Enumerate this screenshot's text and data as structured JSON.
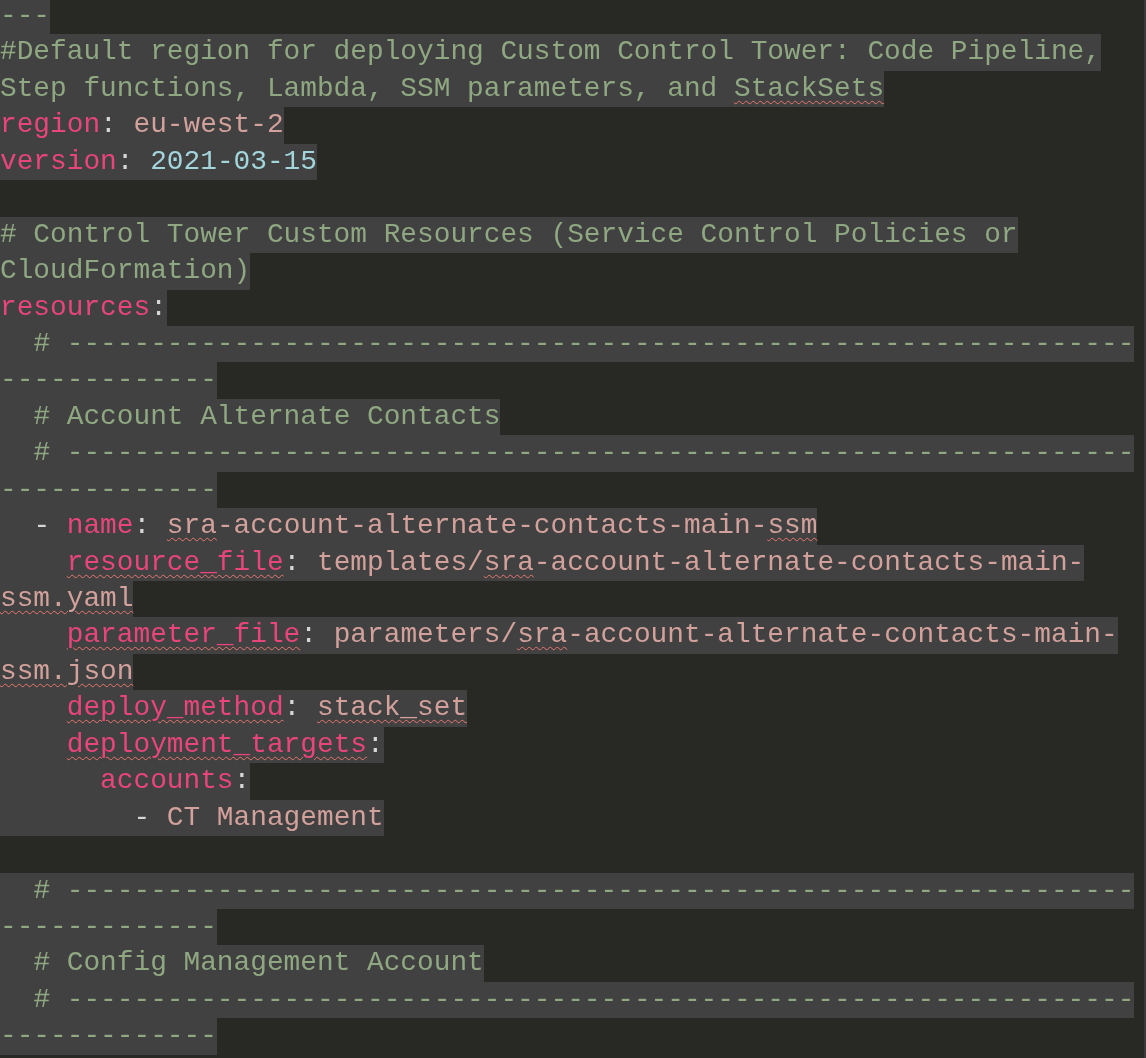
{
  "editor": {
    "lines": [
      {
        "selected": true,
        "tokens": [
          {
            "kind": "comment",
            "text": "---"
          }
        ]
      },
      {
        "selected": true,
        "tokens": [
          {
            "kind": "comment",
            "text": "#Default region for deploying Custom Control Tower: Code Pipeline,"
          }
        ]
      },
      {
        "selected": true,
        "tokens": [
          {
            "kind": "comment",
            "text": "Step functions, Lambda, SSM parameters, and "
          },
          {
            "kind": "comment",
            "text": "StackSets",
            "squiggle": true
          }
        ]
      },
      {
        "selected": true,
        "tokens": [
          {
            "kind": "key",
            "text": "region"
          },
          {
            "kind": "punct",
            "text": ": "
          },
          {
            "kind": "string",
            "text": "eu-west-2"
          }
        ]
      },
      {
        "selected": true,
        "tokens": [
          {
            "kind": "key",
            "text": "version"
          },
          {
            "kind": "punct",
            "text": ": "
          },
          {
            "kind": "number",
            "text": "2021-03-15"
          }
        ]
      },
      {
        "selected": false
      },
      {
        "selected": true,
        "tokens": [
          {
            "kind": "comment",
            "text": "# Control Tower Custom Resources (Service Control Policies or"
          }
        ]
      },
      {
        "selected": true,
        "tokens": [
          {
            "kind": "comment",
            "text": "CloudFormation)"
          }
        ]
      },
      {
        "selected": true,
        "tokens": [
          {
            "kind": "key",
            "text": "resources"
          },
          {
            "kind": "punct",
            "text": ":"
          }
        ]
      },
      {
        "selected": true,
        "tokens": [
          {
            "kind": "comment",
            "text": "  # ----------------------------------------------------------------"
          }
        ]
      },
      {
        "selected": true,
        "tokens": [
          {
            "kind": "comment",
            "text": "-------------"
          }
        ]
      },
      {
        "selected": true,
        "tokens": [
          {
            "kind": "comment",
            "text": "  # Account Alternate Contacts"
          }
        ]
      },
      {
        "selected": true,
        "tokens": [
          {
            "kind": "comment",
            "text": "  # ----------------------------------------------------------------"
          }
        ]
      },
      {
        "selected": true,
        "tokens": [
          {
            "kind": "comment",
            "text": "-------------"
          }
        ]
      },
      {
        "selected": true,
        "tokens": [
          {
            "kind": "punct",
            "text": "  - "
          },
          {
            "kind": "key",
            "text": "name"
          },
          {
            "kind": "punct",
            "text": ": "
          },
          {
            "kind": "string",
            "text": "sra",
            "squiggle": true
          },
          {
            "kind": "string",
            "text": "-account-alternate-contacts-main-"
          },
          {
            "kind": "string",
            "text": "ssm",
            "squiggle": true
          }
        ]
      },
      {
        "selected": true,
        "tokens": [
          {
            "kind": "key",
            "text": "    resource_file",
            "squiggle": true
          },
          {
            "kind": "punct",
            "text": ": "
          },
          {
            "kind": "string",
            "text": "templates/"
          },
          {
            "kind": "string",
            "text": "sra",
            "squiggle": true
          },
          {
            "kind": "string",
            "text": "-account-alternate-contacts-main-"
          }
        ]
      },
      {
        "selected": true,
        "tokens": [
          {
            "kind": "string",
            "text": "ssm.yaml",
            "squiggle": true
          }
        ]
      },
      {
        "selected": true,
        "tokens": [
          {
            "kind": "key",
            "text": "    parameter_file",
            "squiggle": true
          },
          {
            "kind": "punct",
            "text": ": "
          },
          {
            "kind": "string",
            "text": "parameters/"
          },
          {
            "kind": "string",
            "text": "sra",
            "squiggle": true
          },
          {
            "kind": "string",
            "text": "-account-alternate-contacts-main-"
          }
        ]
      },
      {
        "selected": true,
        "tokens": [
          {
            "kind": "string",
            "text": "ssm.json",
            "squiggle": true
          }
        ]
      },
      {
        "selected": true,
        "tokens": [
          {
            "kind": "key",
            "text": "    deploy_method",
            "squiggle": true
          },
          {
            "kind": "punct",
            "text": ": "
          },
          {
            "kind": "string",
            "text": "stack_set",
            "squiggle": true
          }
        ]
      },
      {
        "selected": true,
        "tokens": [
          {
            "kind": "key",
            "text": "    deployment_targets",
            "squiggle": true
          },
          {
            "kind": "punct",
            "text": ":"
          }
        ]
      },
      {
        "selected": true,
        "tokens": [
          {
            "kind": "key",
            "text": "      accounts"
          },
          {
            "kind": "punct",
            "text": ":"
          }
        ]
      },
      {
        "selected": true,
        "tokens": [
          {
            "kind": "punct",
            "text": "        - "
          },
          {
            "kind": "string",
            "text": "CT Management"
          }
        ]
      },
      {
        "selected": false
      },
      {
        "selected": true,
        "tokens": [
          {
            "kind": "comment",
            "text": "  # ----------------------------------------------------------------"
          }
        ]
      },
      {
        "selected": true,
        "tokens": [
          {
            "kind": "comment",
            "text": "-------------"
          }
        ]
      },
      {
        "selected": true,
        "tokens": [
          {
            "kind": "comment",
            "text": "  # Config Management Account"
          }
        ]
      },
      {
        "selected": true,
        "tokens": [
          {
            "kind": "comment",
            "text": "  # ----------------------------------------------------------------"
          }
        ]
      },
      {
        "selected": true,
        "tokens": [
          {
            "kind": "comment",
            "text": "-------------"
          }
        ]
      }
    ]
  }
}
